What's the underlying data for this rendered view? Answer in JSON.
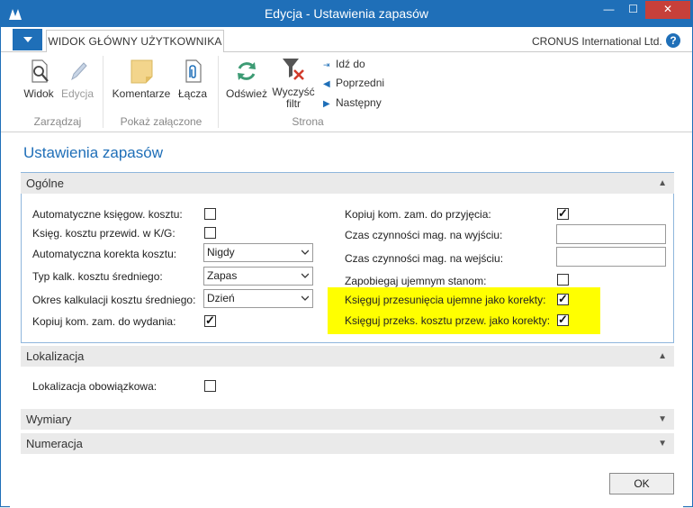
{
  "window": {
    "title": "Edycja - Ustawienia zapasów",
    "min_symbol": "—",
    "max_symbol": "☐",
    "close_symbol": "✕"
  },
  "ribbon_tabs": {
    "active_tab": "WIDOK GŁÓWNY UŻYTKOWNIKA",
    "company": "CRONUS International Ltd.",
    "help": "?"
  },
  "ribbon": {
    "widok": "Widok",
    "edycja": "Edycja",
    "group_zarzadzaj": "Zarządzaj",
    "komentarze": "Komentarze",
    "lacza": "Łącza",
    "group_pokaz": "Pokaż załączone",
    "odswiez": "Odśwież",
    "wyczysc_1": "Wyczyść",
    "wyczysc_2": "filtr",
    "idz_do": "Idź do",
    "poprzedni": "Poprzedni",
    "nastepny": "Następny",
    "group_strona": "Strona"
  },
  "page": {
    "title": "Ustawienia zapasów"
  },
  "ogolne": {
    "header": "Ogólne",
    "left": [
      {
        "label": "Automatyczne księgow. kosztu:",
        "type": "checkbox",
        "checked": false
      },
      {
        "label": "Księg. kosztu przewid. w K/G:",
        "type": "checkbox",
        "checked": false
      },
      {
        "label": "Automatyczna korekta kosztu:",
        "type": "select",
        "value": "Nigdy"
      },
      {
        "label": "Typ kalk. kosztu średniego:",
        "type": "select",
        "value": "Zapas"
      },
      {
        "label": "Okres kalkulacji kosztu średniego:",
        "type": "select",
        "value": "Dzień"
      },
      {
        "label": "Kopiuj kom. zam. do wydania:",
        "type": "checkbox",
        "checked": true
      }
    ],
    "right": [
      {
        "label": "Kopiuj kom. zam. do przyjęcia:",
        "type": "checkbox",
        "checked": true
      },
      {
        "label": "Czas czynności mag. na wyjściu:",
        "type": "text",
        "value": ""
      },
      {
        "label": "Czas czynności mag. na wejściu:",
        "type": "text",
        "value": ""
      },
      {
        "label": "Zapobiegaj ujemnym stanom:",
        "type": "checkbox",
        "checked": false
      },
      {
        "label": "Księguj przesunięcia ujemne jako korekty:",
        "type": "checkbox",
        "checked": true
      },
      {
        "label": "Księguj przeks. kosztu przew. jako korekty:",
        "type": "checkbox",
        "checked": true
      }
    ]
  },
  "lokalizacja": {
    "header": "Lokalizacja",
    "field_label": "Lokalizacja obowiązkowa:",
    "checked": false
  },
  "wymiary": {
    "header": "Wymiary"
  },
  "numeracja": {
    "header": "Numeracja"
  },
  "footer": {
    "ok_label": "OK"
  },
  "colors": {
    "accent": "#1f6fb8",
    "highlight": "#ffff00"
  }
}
